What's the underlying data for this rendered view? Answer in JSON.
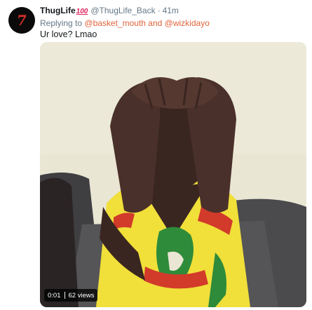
{
  "user": {
    "display_name": "ThugLife",
    "name_emoji": "100",
    "handle": "@ThugLife_Back",
    "separator": "·",
    "time": "41m",
    "avatar_mark": "7"
  },
  "reply": {
    "prefix": "Replying to",
    "mentions": [
      "@basket_mouth",
      "@wizkidayo"
    ],
    "joiner": "and"
  },
  "tweet": {
    "text": "Ur love? Lmao"
  },
  "video": {
    "time": "0:01",
    "views": "62 views"
  },
  "colors": {
    "accent_orange": "#e0633a",
    "handle_gray": "#657786",
    "shirt_yellow": "#f1df3a",
    "shirt_green": "#2e8b3a",
    "shirt_red": "#d23a2a",
    "sofa_gray": "#4b4b4d",
    "wall": "#e9e6d4"
  }
}
